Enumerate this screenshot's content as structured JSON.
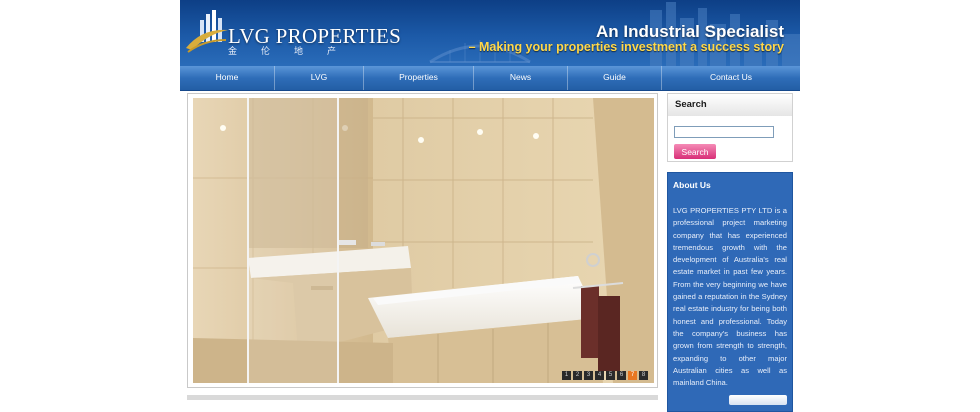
{
  "header": {
    "brand_name": "LVG PROPERTIES",
    "brand_chinese": "金伦地产",
    "tagline": "An Industrial Specialist",
    "subtagline": "– Making your properties investment a success story"
  },
  "nav": {
    "items": [
      {
        "label": "Home"
      },
      {
        "label": "LVG"
      },
      {
        "label": "Properties"
      },
      {
        "label": "News"
      },
      {
        "label": "Guide"
      },
      {
        "label": "Contact Us"
      }
    ]
  },
  "slideshow": {
    "image_subject": "bathroom-interior-photo",
    "pager": [
      "1",
      "2",
      "3",
      "4",
      "5",
      "6",
      "7",
      "8"
    ],
    "active_index": 7
  },
  "search": {
    "title": "Search",
    "input_value": "",
    "button_label": "Search"
  },
  "about": {
    "title": "About Us",
    "text": "LVG PROPERTIES PTY LTD is a professional project marketing company that has experienced tremendous growth with the development of Australia's real estate market in past few years. From the very beginning we have gained a reputation in the Sydney real estate industry for being both honest and professional. Today the company's business has grown from strength to strength, expanding to other major Australian cities as well as mainland China."
  },
  "colors": {
    "header_blue": "#1c5aa8",
    "nav_blue": "#2e6db8",
    "tagline_yellow": "#ffd84a",
    "search_button_pink": "#d82f78",
    "about_panel_blue": "#2f69b7",
    "pager_active_orange": "#e87722"
  }
}
